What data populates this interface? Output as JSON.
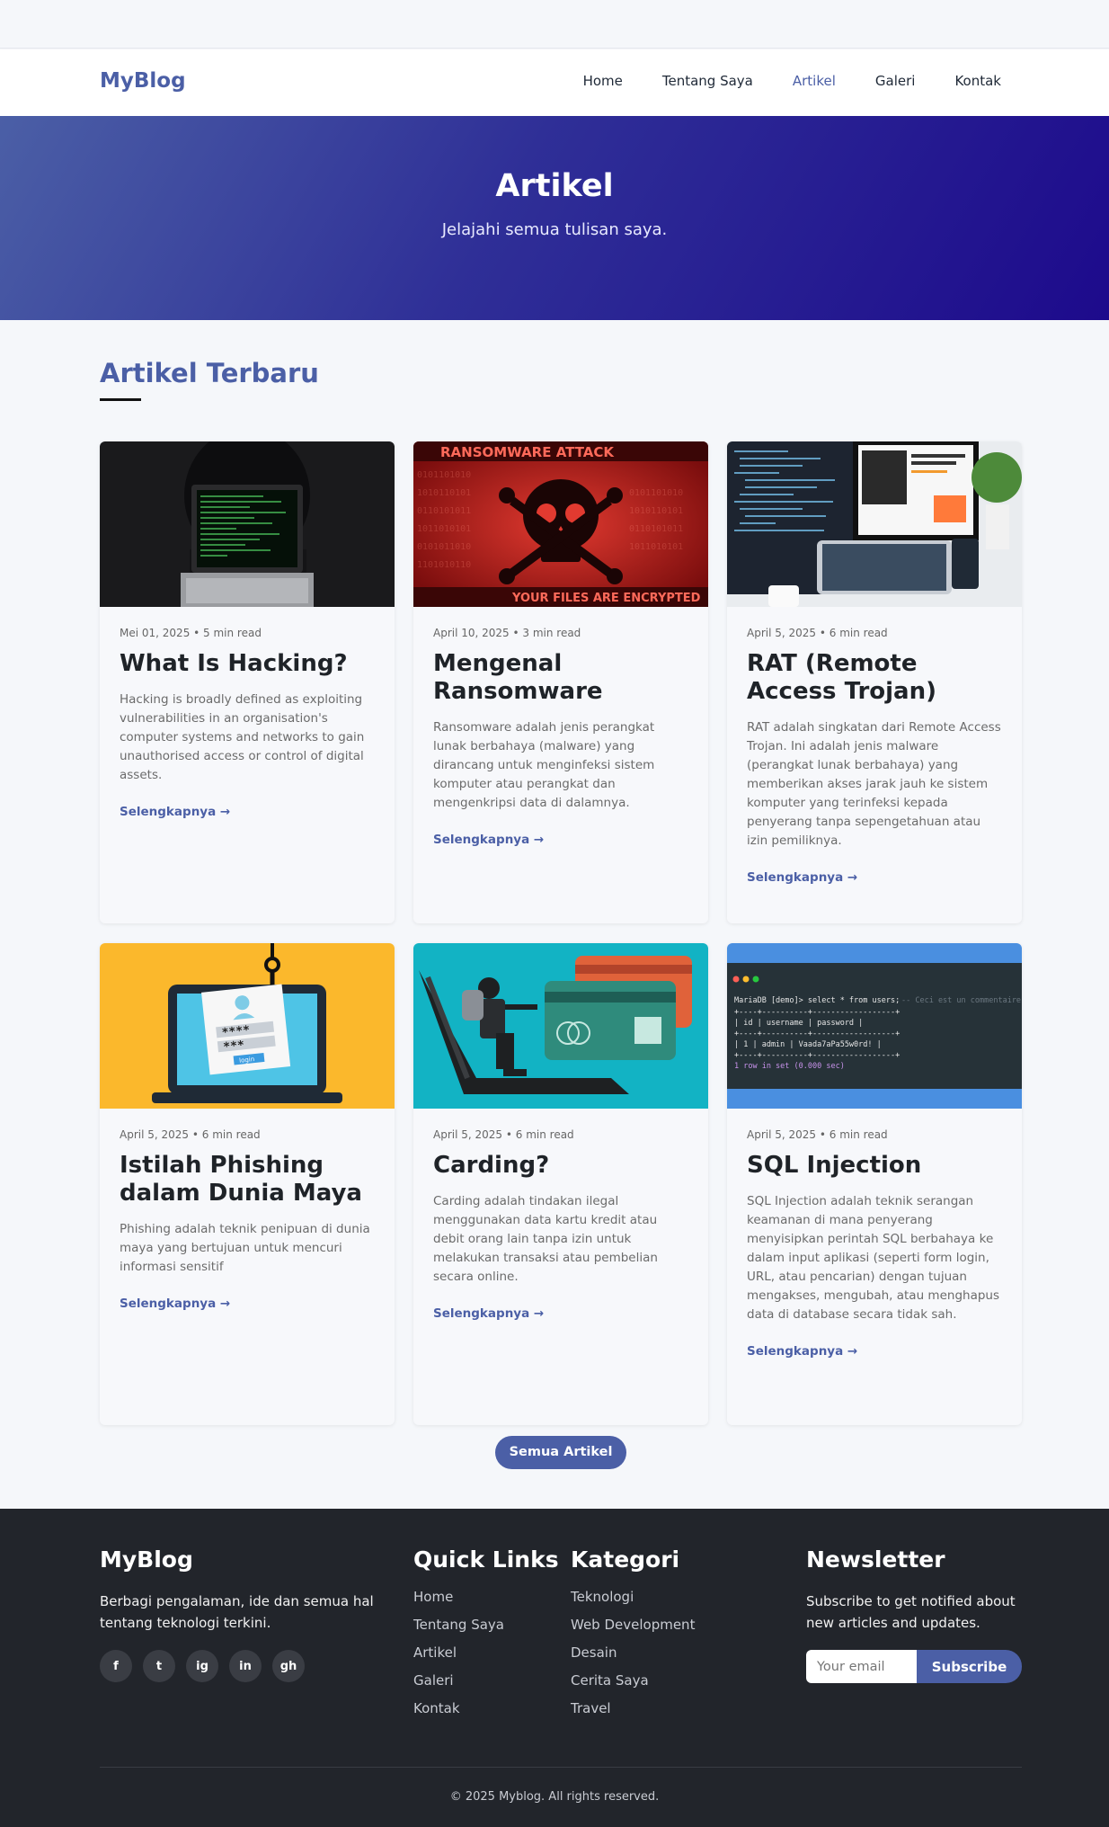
{
  "nav": {
    "brand": "MyBlog",
    "links": [
      "Home",
      "Tentang Saya",
      "Artikel",
      "Galeri",
      "Kontak"
    ],
    "active": "Artikel"
  },
  "hero": {
    "title": "Artikel",
    "subtitle": "Jelajahi semua tulisan saya."
  },
  "section": {
    "title": "Artikel Terbaru"
  },
  "cards": [
    {
      "meta": "Mei 01, 2025 • 5 min read",
      "title": "What Is Hacking?",
      "excerpt": "Hacking is broadly defined as exploiting vulnerabilities in an organisation's computer systems and networks to gain unauthorised access or control of digital assets.",
      "more": "Selengkapnya →",
      "image": "hacker-laptop-image"
    },
    {
      "meta": "April 10, 2025 • 3 min read",
      "title": "Mengenal Ransomware",
      "excerpt": "Ransomware adalah jenis perangkat lunak berbahaya (malware) yang dirancang untuk menginfeksi sistem komputer atau perangkat dan mengenkripsi data di dalamnya.",
      "more": "Selengkapnya →",
      "image": "ransomware-skull-image"
    },
    {
      "meta": "April 5, 2025 • 6 min read",
      "title": "RAT (Remote Access Trojan)",
      "excerpt": "RAT adalah singkatan dari Remote Access Trojan. Ini adalah jenis malware (perangkat lunak berbahaya) yang memberikan akses jarak jauh ke sistem komputer yang terinfeksi kepada penyerang tanpa sepengetahuan atau izin pemiliknya.",
      "more": "Selengkapnya →",
      "image": "monitors-desk-image"
    },
    {
      "meta": "April 5, 2025 • 6 min read",
      "title": "Istilah Phishing dalam Dunia Maya",
      "excerpt": "Phishing adalah teknik penipuan di dunia maya yang bertujuan untuk mencuri informasi sensitif",
      "more": "Selengkapnya →",
      "image": "phishing-hook-image"
    },
    {
      "meta": "April 5, 2025 • 6 min read",
      "title": "Carding?",
      "excerpt": "Carding adalah tindakan ilegal menggunakan data kartu kredit atau debit orang lain tanpa izin untuk melakukan transaksi atau pembelian secara online.",
      "more": "Selengkapnya →",
      "image": "carding-thief-image"
    },
    {
      "meta": "April 5, 2025 • 6 min read",
      "title": "SQL Injection",
      "excerpt": "SQL Injection adalah teknik serangan keamanan di mana penyerang menyisipkan perintah SQL berbahaya ke dalam input aplikasi (seperti form login, URL, atau pencarian) dengan tujuan mengakses, mengubah, atau menghapus data di database secara tidak sah.",
      "more": "Selengkapnya →",
      "image": "sql-terminal-image"
    }
  ],
  "sql_terminal": {
    "prompt": "MariaDB [demo]> select * from users;",
    "comment": "-- Ceci est un commentaire",
    "header": "| id | username | password |",
    "row": "|  1 | admin    | Vaada7aPa55w0rd! |",
    "footer": "1 row in set (0.000 sec)"
  },
  "ransomware_banner": {
    "top": "RANSOMWARE ATTACK",
    "bottom": "YOUR FILES ARE ENCRYPTED"
  },
  "phishing_form": {
    "pass1": "****",
    "pass2": "***",
    "button": "login"
  },
  "all_button": "Semua Artikel",
  "footer": {
    "brand": "MyBlog",
    "about": "Berbagi pengalaman, ide dan semua hal tentang teknologi terkini.",
    "socials": [
      "f",
      "t",
      "ig",
      "in",
      "gh"
    ],
    "quick_title": "Quick Links",
    "quick_links": [
      "Home",
      "Tentang Saya",
      "Artikel",
      "Galeri",
      "Kontak"
    ],
    "cat_title": "Kategori",
    "categories": [
      "Teknologi",
      "Web Development",
      "Desain",
      "Cerita Saya",
      "Travel"
    ],
    "newsletter_title": "Newsletter",
    "newsletter_text": "Subscribe to get notified about new articles and updates.",
    "email_placeholder": "Your email",
    "subscribe": "Subscribe",
    "copyright": "© 2025 Myblog. All rights reserved."
  },
  "colors": {
    "accent": "#4b5fa6",
    "hero_end": "#1d0a8c",
    "footer_bg": "#22252b"
  }
}
